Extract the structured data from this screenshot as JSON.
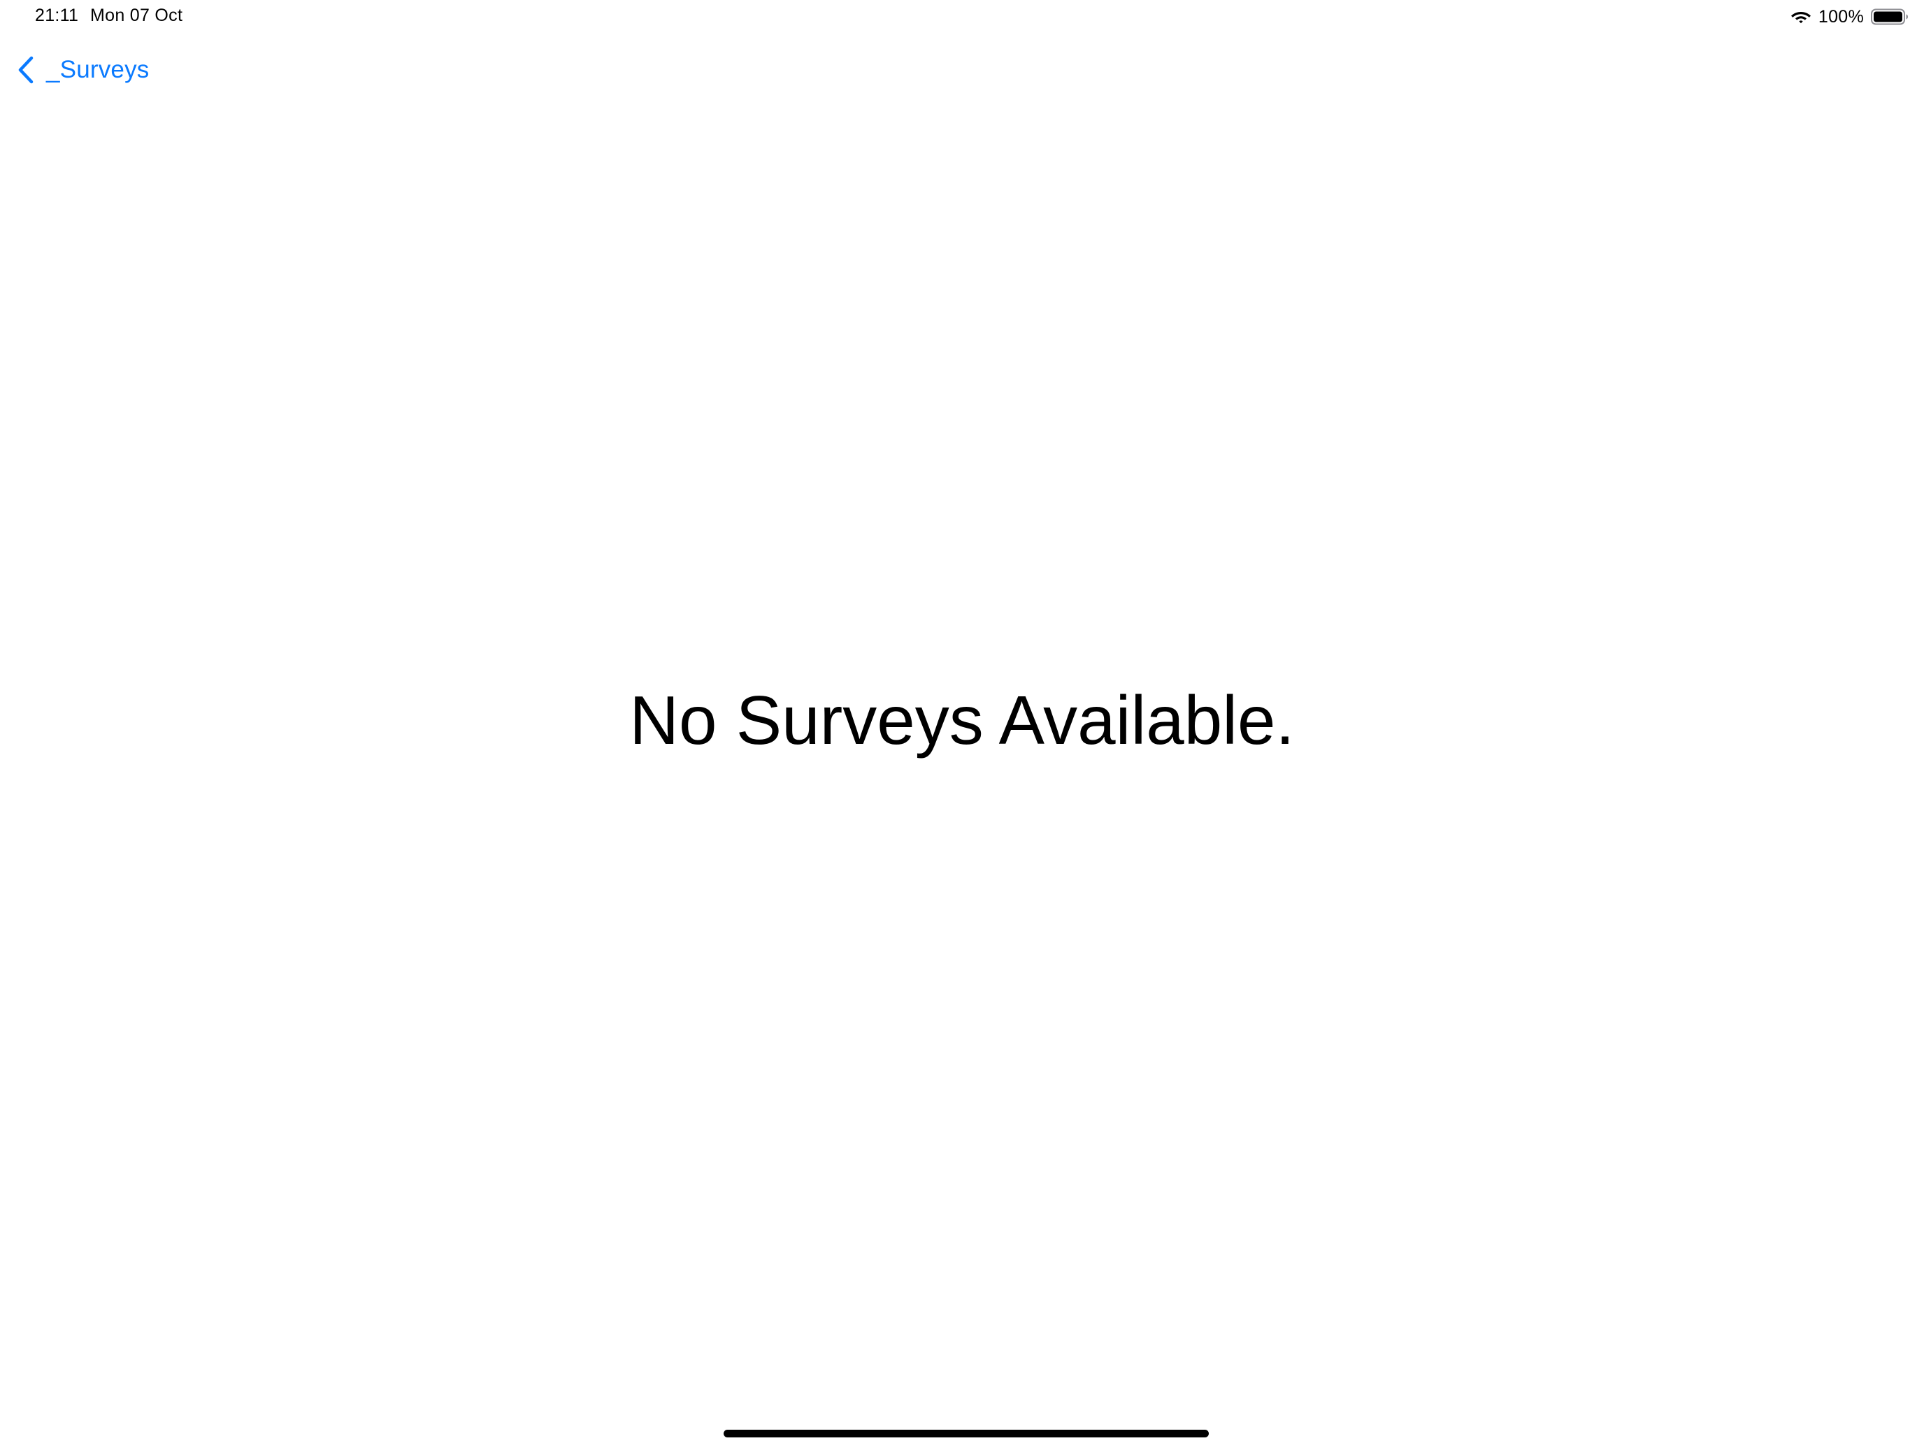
{
  "status_bar": {
    "time": "21:11",
    "date": "Mon 07 Oct",
    "battery_percent": "100%",
    "battery_level": 1.0,
    "wifi_icon": "wifi-icon",
    "battery_icon": "battery-full-icon"
  },
  "nav": {
    "back_label": "_Surveys",
    "back_icon": "chevron-left-icon",
    "accent_color": "#0a7aff"
  },
  "main": {
    "empty_message": "No Surveys Available."
  }
}
